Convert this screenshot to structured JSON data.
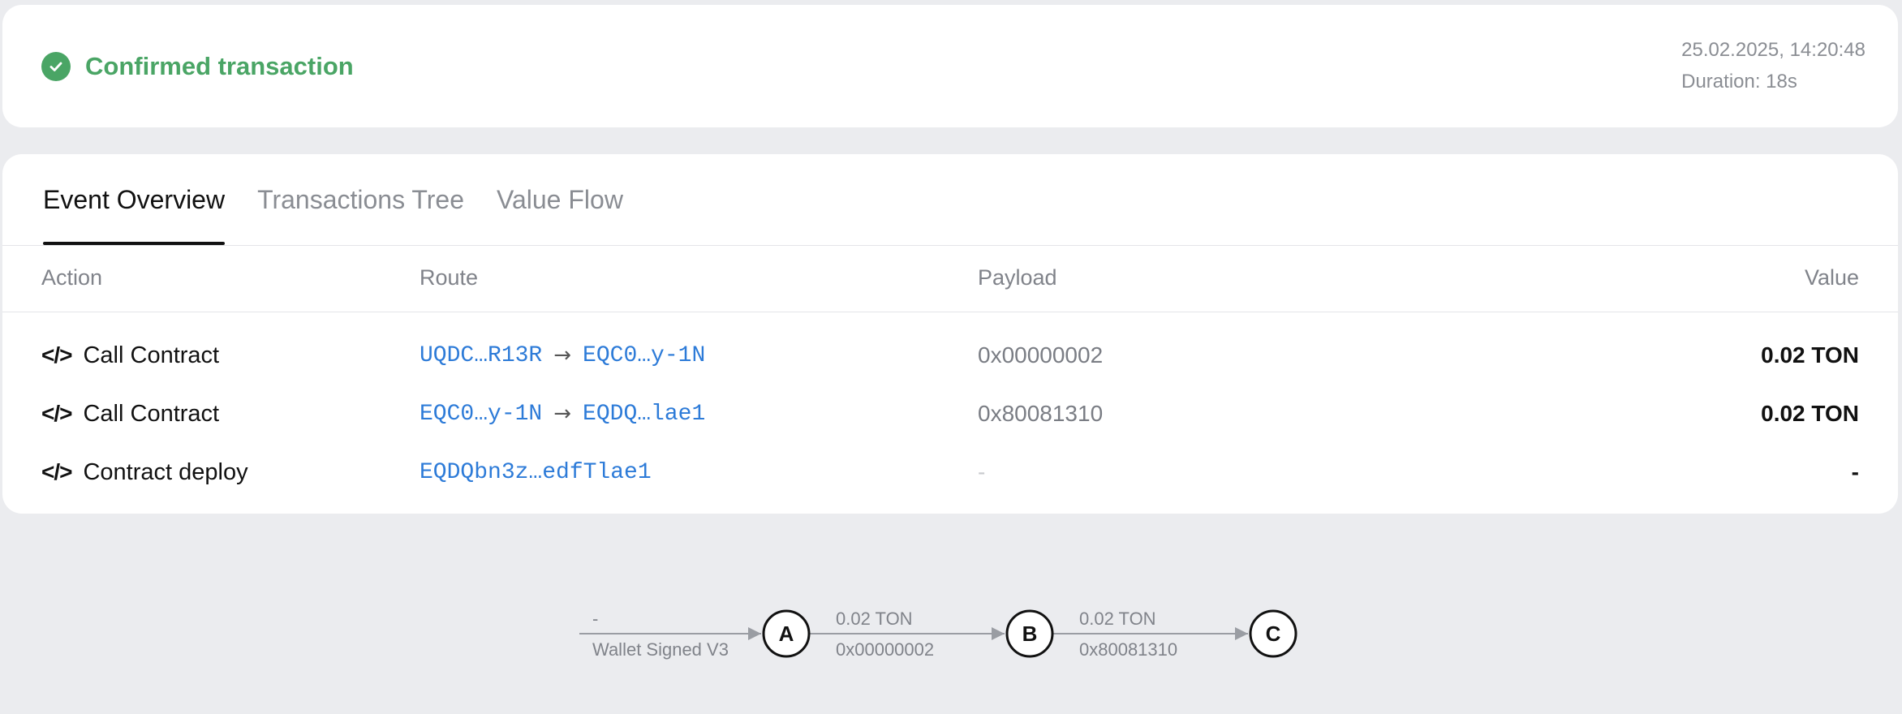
{
  "status": {
    "title": "Confirmed transaction",
    "datetime": "25.02.2025, 14:20:48",
    "duration": "Duration: 18s",
    "color": "#4aa565"
  },
  "tabs": [
    {
      "label": "Event Overview",
      "active": true
    },
    {
      "label": "Transactions Tree",
      "active": false
    },
    {
      "label": "Value Flow",
      "active": false
    }
  ],
  "table": {
    "headers": {
      "action": "Action",
      "route": "Route",
      "payload": "Payload",
      "value": "Value"
    },
    "rows": [
      {
        "icon": "code-icon",
        "action": "Call Contract",
        "from": "UQDC…R13R",
        "arrow": "→",
        "to": "EQC0…y-1N",
        "payload": "0x00000002",
        "value": "0.02 TON"
      },
      {
        "icon": "code-icon",
        "action": "Call Contract",
        "from": "EQC0…y-1N",
        "arrow": "→",
        "to": "EQDQ…lae1",
        "payload": "0x80081310",
        "value": "0.02 TON"
      },
      {
        "icon": "code-icon",
        "action": "Contract deploy",
        "from": "EQDQbn3z…edfTlae1",
        "arrow": "",
        "to": "",
        "payload": "-",
        "value": "-"
      }
    ]
  },
  "flow": {
    "edges": [
      {
        "top": "-",
        "bottom": "Wallet Signed V3"
      },
      {
        "top": "0.02 TON",
        "bottom": "0x00000002"
      },
      {
        "top": "0.02 TON",
        "bottom": "0x80081310"
      }
    ],
    "nodes": [
      "A",
      "B",
      "C"
    ]
  },
  "icons": {
    "check": "check-circle-icon",
    "code": "code-icon",
    "arrow": "arrow-right-icon"
  }
}
